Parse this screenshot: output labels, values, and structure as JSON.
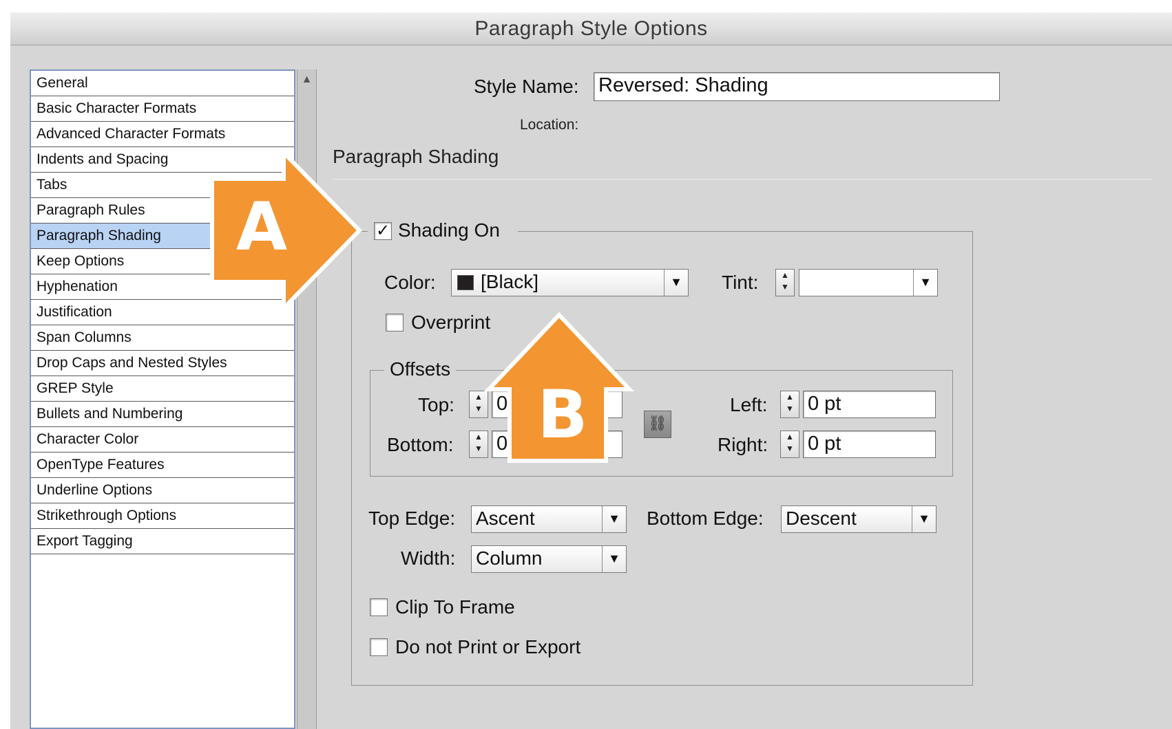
{
  "window": {
    "title": "Paragraph Style Options"
  },
  "sidebar": {
    "items": [
      {
        "label": "General"
      },
      {
        "label": "Basic Character Formats"
      },
      {
        "label": "Advanced Character Formats"
      },
      {
        "label": "Indents and Spacing"
      },
      {
        "label": "Tabs"
      },
      {
        "label": "Paragraph Rules"
      },
      {
        "label": "Paragraph Shading",
        "selected": true
      },
      {
        "label": "Keep Options"
      },
      {
        "label": "Hyphenation"
      },
      {
        "label": "Justification"
      },
      {
        "label": "Span Columns"
      },
      {
        "label": "Drop Caps and Nested Styles"
      },
      {
        "label": "GREP Style"
      },
      {
        "label": "Bullets and Numbering"
      },
      {
        "label": "Character Color"
      },
      {
        "label": "OpenType Features"
      },
      {
        "label": "Underline Options"
      },
      {
        "label": "Strikethrough Options"
      },
      {
        "label": "Export Tagging"
      }
    ]
  },
  "header": {
    "style_name_label": "Style Name:",
    "style_name_value": "Reversed: Shading",
    "location_label": "Location:",
    "section_title": "Paragraph Shading"
  },
  "shading": {
    "shading_on_label": "Shading On",
    "shading_on_checked": true,
    "color_label": "Color:",
    "color_value": "[Black]",
    "swatch_color": "#231f20",
    "tint_label": "Tint:",
    "tint_value": "",
    "overprint_label": "Overprint",
    "overprint_checked": false
  },
  "offsets": {
    "legend": "Offsets",
    "top_label": "Top:",
    "top_value": "0",
    "bottom_label": "Bottom:",
    "bottom_value": "0",
    "left_label": "Left:",
    "left_value": "0 pt",
    "right_label": "Right:",
    "right_value": "0 pt"
  },
  "edges": {
    "top_edge_label": "Top Edge:",
    "top_edge_value": "Ascent",
    "bottom_edge_label": "Bottom Edge:",
    "bottom_edge_value": "Descent",
    "width_label": "Width:",
    "width_value": "Column"
  },
  "options": {
    "clip_label": "Clip To Frame",
    "clip_checked": false,
    "noprint_label": "Do not Print or Export",
    "noprint_checked": false
  },
  "callouts": {
    "a_label": "A",
    "b_label": "B",
    "color": "#f39531",
    "outline": "#ffffff"
  },
  "icons": {
    "checkmark": "✓",
    "dropdown": "▼",
    "spin_up": "▲",
    "spin_down": "▼",
    "scroll_up": "▲",
    "chain": "⛓"
  }
}
